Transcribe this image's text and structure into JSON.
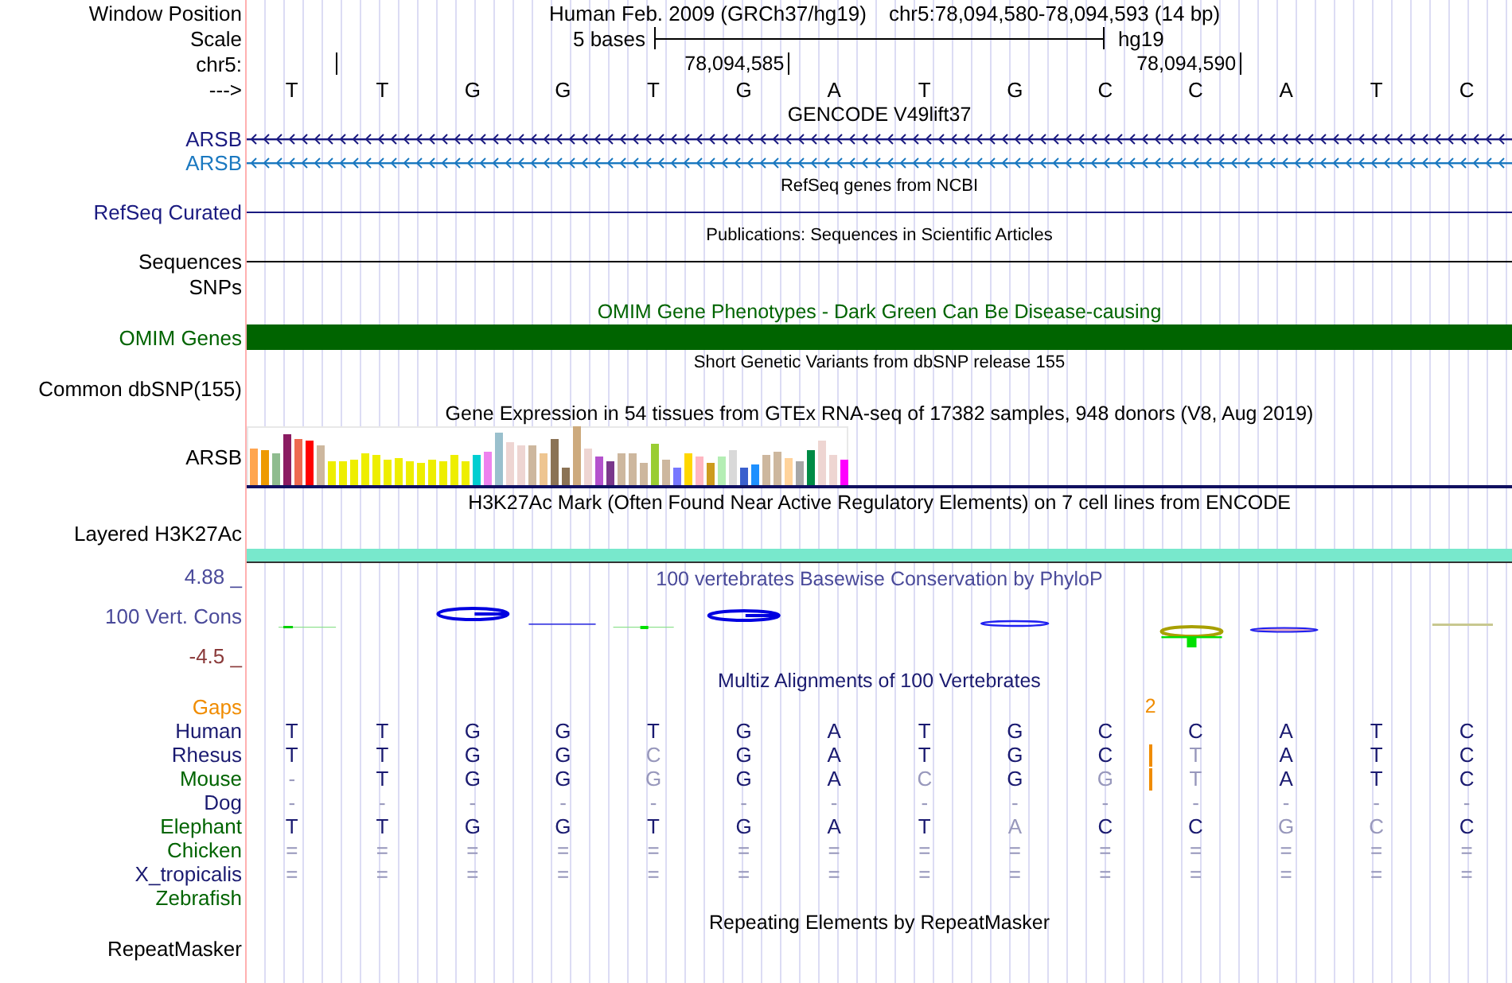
{
  "header": {
    "window_position": {
      "label": "Window Position",
      "assembly": "Human Feb. 2009 (GRCh37/hg19)",
      "range": "chr5:78,094,580-78,094,593 (14 bp)"
    },
    "scale": {
      "label": "Scale",
      "size": "5 bases",
      "assembly": "hg19"
    },
    "ruler": {
      "label": "chr5:",
      "ticks": [
        "78,094,585",
        "78,094,590"
      ]
    },
    "bases": {
      "label": "--->",
      "sequence": [
        "T",
        "T",
        "G",
        "G",
        "T",
        "G",
        "A",
        "T",
        "G",
        "C",
        "C",
        "A",
        "T",
        "C"
      ]
    }
  },
  "tracks": [
    {
      "kind": "gene",
      "title": "GENCODE V49lift37",
      "color": "#000000",
      "rows": [
        {
          "label": "ARSB",
          "color": "#1a1a80"
        },
        {
          "label": "ARSB",
          "color": "#1a78c0"
        }
      ]
    },
    {
      "kind": "line",
      "title": "RefSeq genes from NCBI",
      "label": "RefSeq Curated",
      "color": "#1a1a80"
    },
    {
      "kind": "line",
      "title": "Publications: Sequences in Scientific Articles",
      "label": "Sequences",
      "color": "#000000"
    },
    {
      "kind": "blank",
      "label": "SNPs",
      "color": "#000000"
    },
    {
      "kind": "bar",
      "title": "OMIM Gene Phenotypes - Dark Green Can Be Disease-causing",
      "label": "OMIM Genes",
      "color": "#006400"
    },
    {
      "kind": "blank",
      "title": "Short Genetic Variants from dbSNP release 155",
      "label": "Common dbSNP(155)",
      "color": "#000000"
    },
    {
      "kind": "expression",
      "title": "Gene Expression in 54 tissues from GTEx RNA-seq of 17382 samples, 948 donors (V8, Aug 2019)",
      "label": "ARSB",
      "color": "#000000"
    },
    {
      "kind": "signal",
      "title": "H3K27Ac Mark (Often Found Near Active Regulatory Elements) on 7 cell lines from ENCODE",
      "label": "Layered H3K27Ac",
      "color": "#000000"
    },
    {
      "kind": "wiggle",
      "title": "100 vertebrates Basewise Conservation by PhyloP",
      "label": "100 Vert. Cons",
      "color": "#4a4a9a",
      "max": "4.88 _",
      "min": "-4.5 _"
    },
    {
      "kind": "alignment",
      "title": "Multiz Alignments of 100 Vertebrates",
      "color": "#1a1a70",
      "gaps": {
        "label": "Gaps",
        "count": "2"
      },
      "species": [
        {
          "name": "Human",
          "color": "#1a1a70",
          "insertion": false,
          "bases": [
            "T",
            "T",
            "G",
            "G",
            "T",
            "G",
            "A",
            "T",
            "G",
            "C",
            "C",
            "A",
            "T",
            "C"
          ]
        },
        {
          "name": "Rhesus",
          "color": "#1a1a70",
          "insertion": true,
          "bases": [
            "T",
            "T",
            "G",
            "G",
            "C",
            "G",
            "A",
            "T",
            "G",
            "C",
            "T",
            "A",
            "T",
            "C"
          ]
        },
        {
          "name": "Mouse",
          "color": "#006400",
          "insertion": true,
          "bases": [
            "-",
            "T",
            "G",
            "G",
            "G",
            "G",
            "A",
            "C",
            "G",
            "G",
            "T",
            "A",
            "T",
            "C"
          ]
        },
        {
          "name": "Dog",
          "color": "#1a1a70",
          "insertion": false,
          "bases": [
            "-",
            "-",
            "-",
            "-",
            "-",
            "-",
            "-",
            "-",
            "-",
            "-",
            "-",
            "-",
            "-",
            "-"
          ]
        },
        {
          "name": "Elephant",
          "color": "#006400",
          "insertion": false,
          "bases": [
            "T",
            "T",
            "G",
            "G",
            "T",
            "G",
            "A",
            "T",
            "A",
            "C",
            "C",
            "G",
            "C",
            "C"
          ]
        },
        {
          "name": "Chicken",
          "color": "#006400",
          "insertion": false,
          "bases": [
            "=",
            "=",
            "=",
            "=",
            "=",
            "=",
            "=",
            "=",
            "=",
            "=",
            "=",
            "=",
            "=",
            "="
          ]
        },
        {
          "name": "X_tropicalis",
          "color": "#1a1a70",
          "insertion": false,
          "bases": [
            "=",
            "=",
            "=",
            "=",
            "=",
            "=",
            "=",
            "=",
            "=",
            "=",
            "=",
            "=",
            "=",
            "="
          ]
        },
        {
          "name": "Zebrafish",
          "color": "#006400",
          "insertion": false
        }
      ]
    },
    {
      "kind": "blank",
      "title": "Repeating Elements by RepeatMasker",
      "label": "RepeatMasker",
      "color": "#000000"
    }
  ]
}
